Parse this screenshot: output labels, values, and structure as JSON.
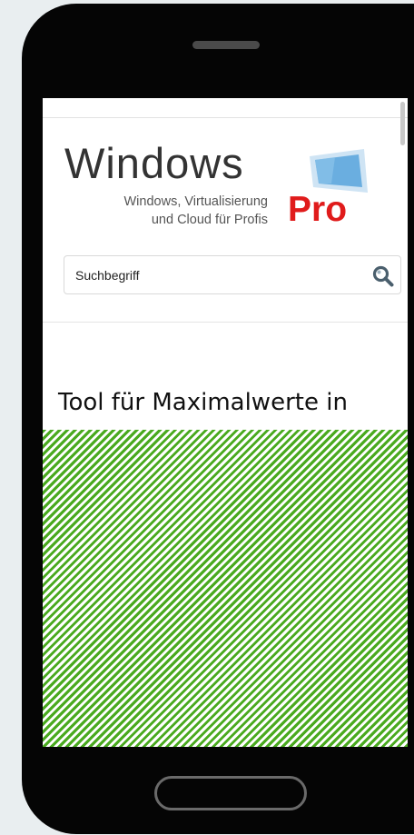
{
  "logo": {
    "word": "Windows",
    "tagline": "Windows, Virtualisierung\nund Cloud für Profis",
    "pro": "Pro"
  },
  "search": {
    "placeholder": "Suchbegriff",
    "value": ""
  },
  "article": {
    "title": "Tool für Maximalwerte in"
  },
  "colors": {
    "accent_red": "#e01b1b",
    "logo_blue": "#6aaee0",
    "overlay_green": "#4aaa1f",
    "phone_frame": "#050505"
  },
  "icons": {
    "search": "search-icon"
  }
}
